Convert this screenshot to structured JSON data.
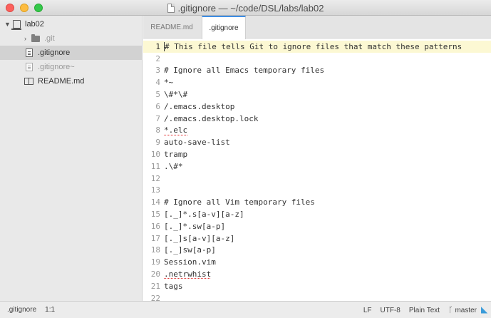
{
  "window": {
    "title": ".gitignore — ~/code/DSL/labs/lab02"
  },
  "sidebar": {
    "root": {
      "label": "lab02",
      "icon": "project-icon"
    },
    "items": [
      {
        "label": ".git",
        "icon": "folder-icon"
      },
      {
        "label": ".gitignore",
        "icon": "doc-icon"
      },
      {
        "label": ".gitignore~",
        "icon": "doc-icon"
      },
      {
        "label": "README.md",
        "icon": "book-icon"
      }
    ]
  },
  "tabs": [
    {
      "label": "README.md"
    },
    {
      "label": ".gitignore"
    }
  ],
  "editor": {
    "lines": [
      {
        "num": "1",
        "text": "# This file tells Git to ignore files that match these patterns"
      },
      {
        "num": "2",
        "text": ""
      },
      {
        "num": "3",
        "text": "# Ignore all Emacs temporary files"
      },
      {
        "num": "4",
        "text": "*~"
      },
      {
        "num": "5",
        "text": "\\#*\\#"
      },
      {
        "num": "6",
        "text": "/.emacs.desktop"
      },
      {
        "num": "7",
        "text": "/.emacs.desktop.lock"
      },
      {
        "num": "8",
        "text": "*.elc"
      },
      {
        "num": "9",
        "text": "auto-save-list"
      },
      {
        "num": "10",
        "text": "tramp"
      },
      {
        "num": "11",
        "text": ".\\#*"
      },
      {
        "num": "12",
        "text": ""
      },
      {
        "num": "13",
        "text": ""
      },
      {
        "num": "14",
        "text": "# Ignore all Vim temporary files"
      },
      {
        "num": "15",
        "text": "[._]*.s[a-v][a-z]"
      },
      {
        "num": "16",
        "text": "[._]*.sw[a-p]"
      },
      {
        "num": "17",
        "text": "[._]s[a-v][a-z]"
      },
      {
        "num": "18",
        "text": "[._]sw[a-p]"
      },
      {
        "num": "19",
        "text": "Session.vim"
      },
      {
        "num": "20",
        "text": ".netrwhist"
      },
      {
        "num": "21",
        "text": "tags"
      },
      {
        "num": "22",
        "text": ""
      }
    ]
  },
  "status": {
    "file": ".gitignore",
    "position": "1:1",
    "line_ending": "LF",
    "encoding": "UTF-8",
    "grammar": "Plain Text",
    "branch": "master"
  }
}
